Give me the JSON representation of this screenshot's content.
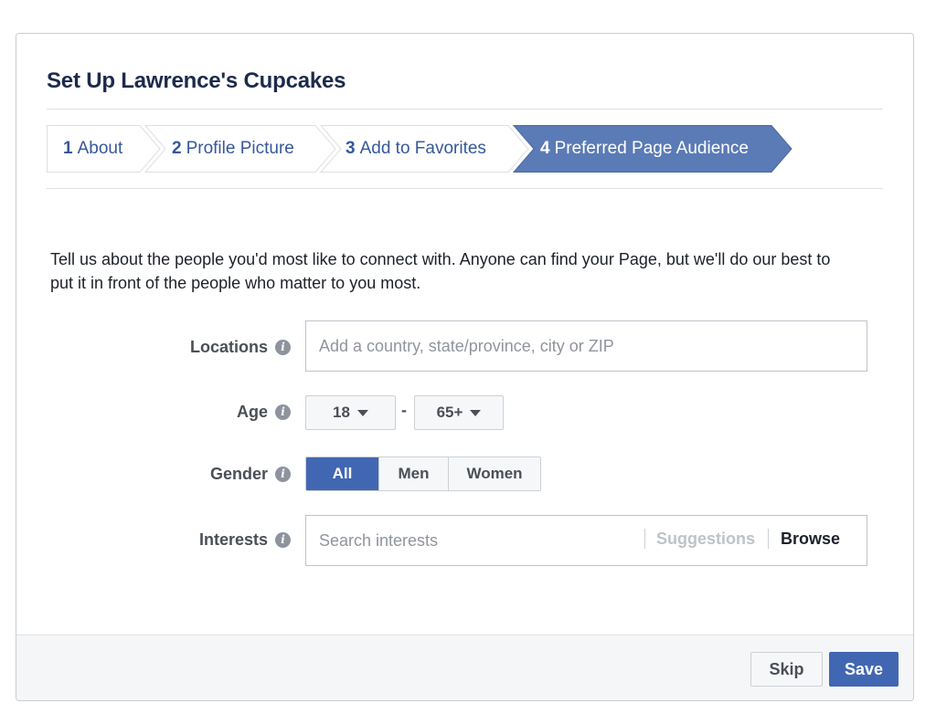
{
  "dialog": {
    "title": "Set Up Lawrence's Cupcakes"
  },
  "steps": [
    {
      "num": "1",
      "label": "About"
    },
    {
      "num": "2",
      "label": "Profile Picture"
    },
    {
      "num": "3",
      "label": "Add to Favorites"
    },
    {
      "num": "4",
      "label": "Preferred Page Audience",
      "active": true
    }
  ],
  "intro_text": "Tell us about the people you'd most like to connect with. Anyone can find your Page, but we'll do our best to put it in front of the people who matter to you most.",
  "fields": {
    "locations": {
      "label": "Locations",
      "placeholder": "Add a country, state/province, city or ZIP"
    },
    "age": {
      "label": "Age",
      "min": "18",
      "max": "65+",
      "separator": "-"
    },
    "gender": {
      "label": "Gender",
      "options": [
        "All",
        "Men",
        "Women"
      ],
      "selected": "All"
    },
    "interests": {
      "label": "Interests",
      "placeholder": "Search interests",
      "suggestions_label": "Suggestions",
      "browse_label": "Browse"
    }
  },
  "footer": {
    "skip_label": "Skip",
    "save_label": "Save"
  },
  "colors": {
    "accent": "#4267b2",
    "link": "#365899",
    "active_step": "#5b7bb6"
  },
  "icons": {
    "info": "info-icon",
    "dropdown": "chevron-down-icon"
  }
}
